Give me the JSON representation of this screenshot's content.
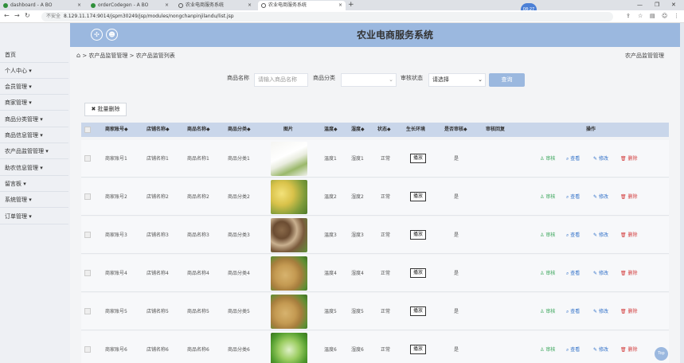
{
  "browser": {
    "tabs": [
      {
        "label": "dashboard - A BO",
        "color": "#2f8f3a"
      },
      {
        "label": "orderCodegen - A BO",
        "color": "#2f8f3a"
      },
      {
        "label": "农业电商服务系统",
        "color": "#555555"
      },
      {
        "label": "农业电商服务系统",
        "color": "#555555"
      }
    ],
    "clock": "08:27",
    "insecure": "不安全",
    "url": "8.129.11.174:9014/jspm30249/jsp/modules/nongchanpinjilandu/list.jsp"
  },
  "header": {
    "title": "农业电商服务系统"
  },
  "sidebar": {
    "items": [
      {
        "label": "首页"
      },
      {
        "label": "个人中心 ▾"
      },
      {
        "label": "会员管理 ▾"
      },
      {
        "label": "商家管理 ▾"
      },
      {
        "label": "商品分类管理 ▾"
      },
      {
        "label": "商品信息管理 ▾"
      },
      {
        "label": "农产品监管管理 ▾"
      },
      {
        "label": "助农信息管理 ▾"
      },
      {
        "label": "留言板 ▾"
      },
      {
        "label": "系统管理 ▾"
      },
      {
        "label": "订单管理 ▾"
      }
    ]
  },
  "breadcrumb": {
    "home_sep": ">",
    "level1": "农产品监管管理",
    "sep": ">",
    "level2": "农产品监管列表",
    "right": "农产品监管管理"
  },
  "search": {
    "name_label": "商品名称",
    "name_placeholder": "请输入商品名称",
    "category_label": "商品分类",
    "status_label": "审核状态",
    "status_value": "请选择",
    "button": "查询"
  },
  "batch_delete": "✖ 批量删除",
  "table": {
    "headers": [
      "商家账号◆",
      "店铺名称◆",
      "商品名称◆",
      "商品分类◆",
      "图片",
      "温度◆",
      "湿度◆",
      "状态◆",
      "生长环境",
      "是否审核◆",
      "审核回复",
      "操作"
    ],
    "rows": [
      {
        "account": "商家账号1",
        "shop": "店铺名称1",
        "product": "商品名称1",
        "category": "商品分类1",
        "image": "radish",
        "temp": "温度1",
        "humid": "湿度1",
        "status": "正常",
        "env": "播放",
        "audited": "是"
      },
      {
        "account": "商家账号2",
        "shop": "店铺名称2",
        "product": "商品名称2",
        "category": "商品分类2",
        "image": "corn",
        "temp": "温度2",
        "humid": "湿度2",
        "status": "正常",
        "env": "播放",
        "audited": "是"
      },
      {
        "account": "商家账号3",
        "shop": "店铺名称3",
        "product": "商品名称3",
        "category": "商品分类3",
        "image": "mushroom",
        "temp": "温度3",
        "humid": "湿度3",
        "status": "正常",
        "env": "播放",
        "audited": "是"
      },
      {
        "account": "商家账号4",
        "shop": "店铺名称4",
        "product": "商品名称4",
        "category": "商品分类4",
        "image": "potato",
        "temp": "温度4",
        "humid": "湿度4",
        "status": "正常",
        "env": "播放",
        "audited": "是"
      },
      {
        "account": "商家账号5",
        "shop": "店铺名称5",
        "product": "商品名称5",
        "category": "商品分类5",
        "image": "potato",
        "temp": "温度5",
        "humid": "湿度5",
        "status": "正常",
        "env": "播放",
        "audited": "是"
      },
      {
        "account": "商家账号6",
        "shop": "店铺名称6",
        "product": "商品名称6",
        "category": "商品分类6",
        "image": "greens",
        "temp": "温度6",
        "humid": "湿度6",
        "status": "正常",
        "env": "播放",
        "audited": "是"
      }
    ],
    "actions": {
      "audit": "审核",
      "view": "查看",
      "edit": "修改",
      "delete": "删除"
    }
  },
  "top_button": "Top"
}
